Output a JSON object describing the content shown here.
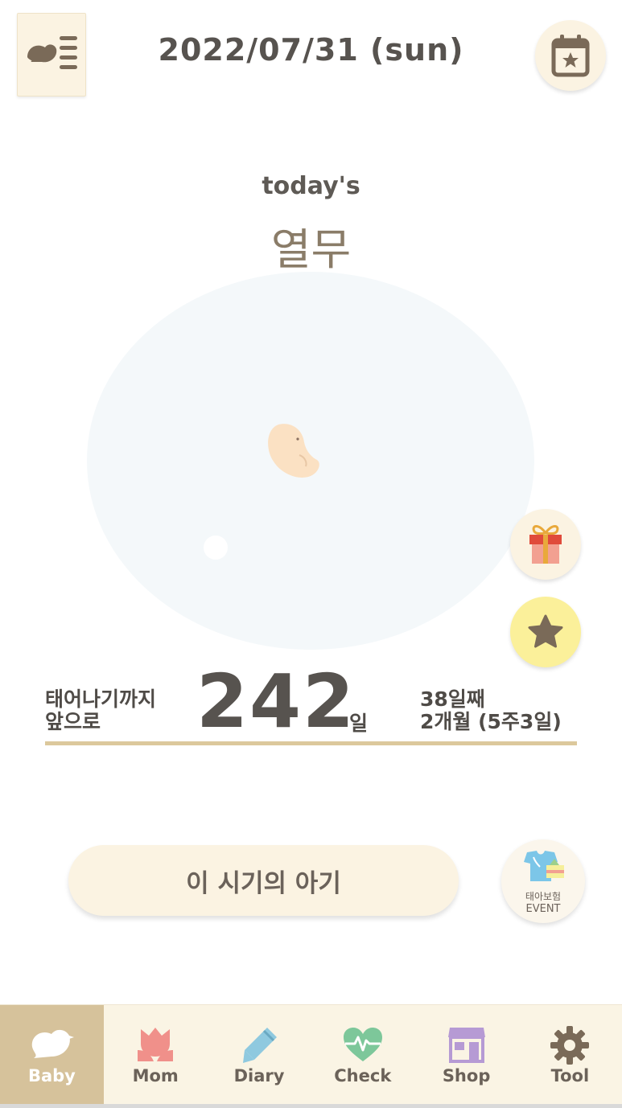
{
  "header": {
    "date": "2022/07/31 (sun)",
    "menu_icon": "bird-list-icon",
    "calendar_icon": "calendar-star-icon"
  },
  "today": {
    "label": "today's",
    "food": "열무"
  },
  "countdown": {
    "until_label": "태어나기까지\n앞으로",
    "days_remaining": "242",
    "unit": "일",
    "elapsed_day": "38일째",
    "elapsed_period": "2개월 (5주3일)"
  },
  "side_buttons": {
    "gift_icon": "gift-icon",
    "favorite_icon": "star-icon"
  },
  "baby_stage_button": "이 시기의 아기",
  "event": {
    "title": "태아보험",
    "subtitle": "EVENT",
    "icon": "baby-clothes-icon"
  },
  "nav": {
    "items": [
      {
        "label": "Baby",
        "icon": "bird-icon",
        "active": true
      },
      {
        "label": "Mom",
        "icon": "tulip-icon",
        "active": false
      },
      {
        "label": "Diary",
        "icon": "pencil-icon",
        "active": false
      },
      {
        "label": "Check",
        "icon": "heart-pulse-icon",
        "active": false
      },
      {
        "label": "Shop",
        "icon": "store-icon",
        "active": false
      },
      {
        "label": "Tool",
        "icon": "gear-icon",
        "active": false
      }
    ]
  },
  "colors": {
    "accent": "#d6c29b",
    "cream": "#fbf3e2",
    "text": "#57534f",
    "star_button": "#fbf09a",
    "womb": "#f4f8fa"
  }
}
